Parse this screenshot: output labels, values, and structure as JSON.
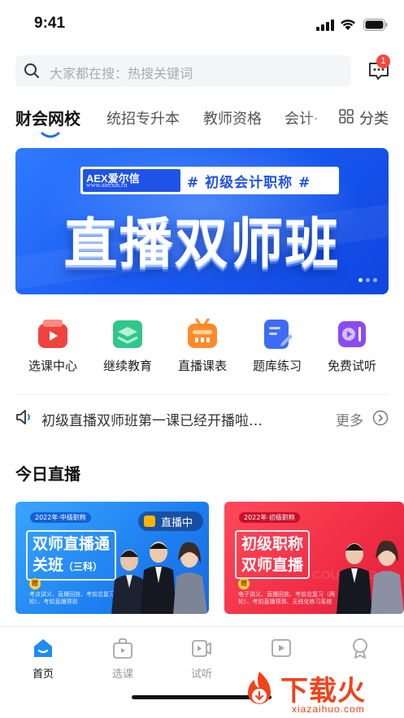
{
  "status_bar": {
    "time": "9:41"
  },
  "search": {
    "placeholder": "大家都在搜：热搜关键词"
  },
  "messages": {
    "badge": "1"
  },
  "tabs": {
    "items": [
      {
        "label": "财会网校",
        "active": true
      },
      {
        "label": "统招专升本"
      },
      {
        "label": "教师资格"
      },
      {
        "label": "会计·"
      }
    ],
    "category_label": "分类"
  },
  "banner": {
    "logo": "AEX爱尔信",
    "logo_url": "www.aierxin.cn",
    "tag": "# 初级会计职称 #",
    "headline": "直播双师班",
    "page_count": 3,
    "active_page": 1
  },
  "quick_entries": [
    {
      "label": "选课中心",
      "icon": "course-center-icon",
      "color": "#f0433f"
    },
    {
      "label": "继续教育",
      "icon": "continuing-education-icon",
      "color": "#2fc78a"
    },
    {
      "label": "直播课表",
      "icon": "live-schedule-icon",
      "color": "#ff8a2a"
    },
    {
      "label": "题库练习",
      "icon": "question-bank-icon",
      "color": "#3d6bf5"
    },
    {
      "label": "免费试听",
      "icon": "free-trial-icon",
      "color": "#8a4cf0"
    }
  ],
  "notice": {
    "text": "初级直播双师班第一课已经开播啦…",
    "more": "更多"
  },
  "today_live": {
    "title": "今日直播",
    "cards": [
      {
        "pill": "2022年·中级职称",
        "title_line1": "双师直播通",
        "title_line2": "关班",
        "title_suffix": "（三科）",
        "gift": "赠",
        "desc": "考点讲义、直播回放、考前总复习（两轮）、考前直播预测",
        "live_label": "直播中"
      },
      {
        "pill": "2022年·初级职称",
        "title_line1": "初级职称",
        "title_line2": "双师直播",
        "gift": "赠",
        "desc": "电子讲义、直播回放、考前总复习（两轮）、考前直播预测、无线化练习系统",
        "watermark": "COUNTING"
      }
    ]
  },
  "bottom_nav": [
    {
      "label": "首页",
      "icon": "home-icon",
      "active": true
    },
    {
      "label": "选课",
      "icon": "course-bag-icon"
    },
    {
      "label": "试听",
      "icon": "trial-video-icon"
    },
    {
      "label": "",
      "icon": "play-icon"
    },
    {
      "label": "",
      "icon": "profile-icon"
    }
  ],
  "watermark": {
    "text": "下载火",
    "url": "xiazaihuo.com"
  },
  "colors": {
    "accent": "#1f6cf0",
    "banner_blue": "#1a5cf3",
    "badge_red": "#f24a3d"
  }
}
